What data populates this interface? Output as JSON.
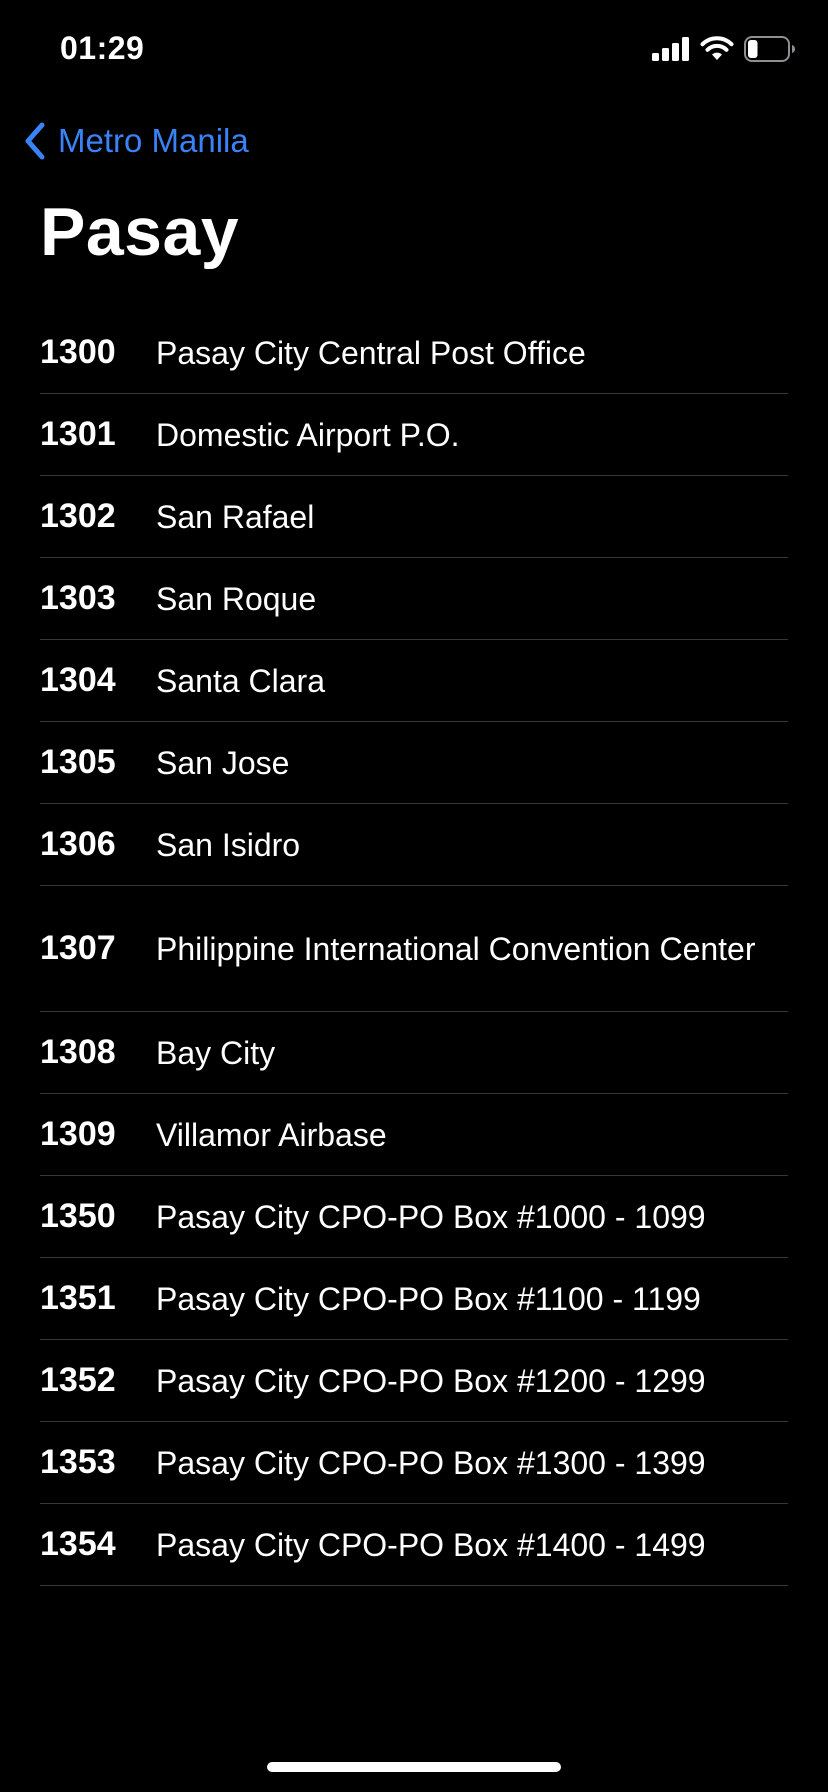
{
  "status_bar": {
    "time": "01:29",
    "icons": [
      "cellular-signal-icon",
      "wifi-icon",
      "battery-icon"
    ],
    "battery_level": 0.25
  },
  "nav": {
    "back_label": "Metro Manila",
    "back_icon": "chevron-left-icon",
    "accent_color": "#3a82f7"
  },
  "page": {
    "title": "Pasay"
  },
  "zip_codes": [
    {
      "code": "1300",
      "name": "Pasay City Central Post Office"
    },
    {
      "code": "1301",
      "name": "Domestic Airport P.O."
    },
    {
      "code": "1302",
      "name": "San Rafael"
    },
    {
      "code": "1303",
      "name": "San Roque"
    },
    {
      "code": "1304",
      "name": "Santa Clara"
    },
    {
      "code": "1305",
      "name": "San Jose"
    },
    {
      "code": "1306",
      "name": "San Isidro"
    },
    {
      "code": "1307",
      "name": "Philippine International Convention Center"
    },
    {
      "code": "1308",
      "name": "Bay City"
    },
    {
      "code": "1309",
      "name": "Villamor Airbase"
    },
    {
      "code": "1350",
      "name": "Pasay City CPO-PO Box #1000 - 1099"
    },
    {
      "code": "1351",
      "name": "Pasay City CPO-PO Box #1100 - 1199"
    },
    {
      "code": "1352",
      "name": "Pasay City CPO-PO Box #1200 - 1299"
    },
    {
      "code": "1353",
      "name": "Pasay City CPO-PO Box #1300 - 1399"
    },
    {
      "code": "1354",
      "name": "Pasay City CPO-PO Box #1400 - 1499"
    }
  ]
}
